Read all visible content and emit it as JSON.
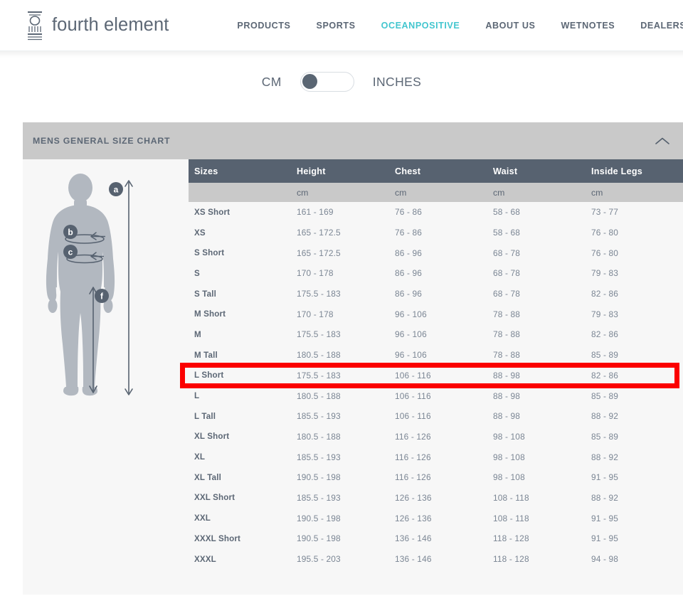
{
  "header": {
    "brand_name": "fourth element",
    "brand_mark_icon": "fourth-element-logo-icon",
    "nav": [
      {
        "label": "PRODUCTS",
        "active": false
      },
      {
        "label": "SPORTS",
        "active": false
      },
      {
        "label": "OCEANPOSITIVE",
        "active": true
      },
      {
        "label": "ABOUT US",
        "active": false
      },
      {
        "label": "WETNOTES",
        "active": false
      },
      {
        "label": "DEALERS",
        "active": false
      }
    ],
    "active_color": "#43c6cf",
    "text_color": "#5c6775"
  },
  "unit_toggle": {
    "left_label": "CM",
    "right_label": "INCHES",
    "selected": "CM",
    "knob_position": "left",
    "knob_color": "#5a6673"
  },
  "panel": {
    "title": "MENS GENERAL SIZE CHART",
    "collapse_icon": "chevron-up-icon",
    "expanded": true,
    "header_bg": "#c9c9c9",
    "body_bg": "#f7f7f7"
  },
  "figure": {
    "name": "body-measurement-diagram",
    "labels": [
      {
        "id": "a",
        "meaning": "height"
      },
      {
        "id": "b",
        "meaning": "chest"
      },
      {
        "id": "c",
        "meaning": "waist"
      },
      {
        "id": "f",
        "meaning": "inside legs"
      }
    ],
    "silhouette_color": "#b2b8c0",
    "marker_color": "#576270"
  },
  "table": {
    "columns": [
      "Sizes",
      "Height",
      "Chest",
      "Waist",
      "Inside Legs"
    ],
    "units": [
      "",
      "cm",
      "cm",
      "cm",
      "cm"
    ],
    "header_bg": "#576270",
    "rows": [
      {
        "size": "XS Short",
        "height": "161 - 169",
        "chest": "76 - 86",
        "waist": "58 - 68",
        "inside_legs": "73 - 77",
        "highlighted": false
      },
      {
        "size": "XS",
        "height": "165 - 172.5",
        "chest": "76 - 86",
        "waist": "58 - 68",
        "inside_legs": "76 - 80",
        "highlighted": false
      },
      {
        "size": "S Short",
        "height": "165 - 172.5",
        "chest": "86 - 96",
        "waist": "68 - 78",
        "inside_legs": "76 - 80",
        "highlighted": false
      },
      {
        "size": "S",
        "height": "170 - 178",
        "chest": "86 - 96",
        "waist": "68 - 78",
        "inside_legs": "79 - 83",
        "highlighted": false
      },
      {
        "size": "S Tall",
        "height": "175.5 - 183",
        "chest": "86 - 96",
        "waist": "68 - 78",
        "inside_legs": "82 - 86",
        "highlighted": false
      },
      {
        "size": "M Short",
        "height": "170 - 178",
        "chest": "96 - 106",
        "waist": "78 - 88",
        "inside_legs": "79 - 83",
        "highlighted": false
      },
      {
        "size": "M",
        "height": "175.5 - 183",
        "chest": "96 - 106",
        "waist": "78 - 88",
        "inside_legs": "82 - 86",
        "highlighted": false
      },
      {
        "size": "M Tall",
        "height": "180.5 - 188",
        "chest": "96 - 106",
        "waist": "78 - 88",
        "inside_legs": "85 - 89",
        "highlighted": false
      },
      {
        "size": "L Short",
        "height": "175.5 - 183",
        "chest": "106 - 116",
        "waist": "88 - 98",
        "inside_legs": "82 - 86",
        "highlighted": true
      },
      {
        "size": "L",
        "height": "180.5 - 188",
        "chest": "106 - 116",
        "waist": "88 - 98",
        "inside_legs": "85 - 89",
        "highlighted": false
      },
      {
        "size": "L Tall",
        "height": "185.5 - 193",
        "chest": "106 - 116",
        "waist": "88 - 98",
        "inside_legs": "88 - 92",
        "highlighted": false
      },
      {
        "size": "XL Short",
        "height": "180.5 - 188",
        "chest": "116 - 126",
        "waist": "98 - 108",
        "inside_legs": "85 - 89",
        "highlighted": false
      },
      {
        "size": "XL",
        "height": "185.5 - 193",
        "chest": "116 - 126",
        "waist": "98 - 108",
        "inside_legs": "88 - 92",
        "highlighted": false
      },
      {
        "size": "XL Tall",
        "height": "190.5 - 198",
        "chest": "116 - 126",
        "waist": "98 - 108",
        "inside_legs": "91 - 95",
        "highlighted": false
      },
      {
        "size": "XXL Short",
        "height": "185.5 - 193",
        "chest": "126 - 136",
        "waist": "108 - 118",
        "inside_legs": "88 - 92",
        "highlighted": false
      },
      {
        "size": "XXL",
        "height": "190.5 - 198",
        "chest": "126 - 136",
        "waist": "108 - 118",
        "inside_legs": "91 - 95",
        "highlighted": false
      },
      {
        "size": "XXXL Short",
        "height": "190.5 - 198",
        "chest": "136 - 146",
        "waist": "118 - 128",
        "inside_legs": "91 - 95",
        "highlighted": false
      },
      {
        "size": "XXXL",
        "height": "195.5 - 203",
        "chest": "136 - 146",
        "waist": "118 - 128",
        "inside_legs": "94 - 98",
        "highlighted": false
      }
    ]
  },
  "annotation": {
    "type": "highlight-rectangle",
    "color": "#fb0000",
    "target_row": "L Short"
  }
}
